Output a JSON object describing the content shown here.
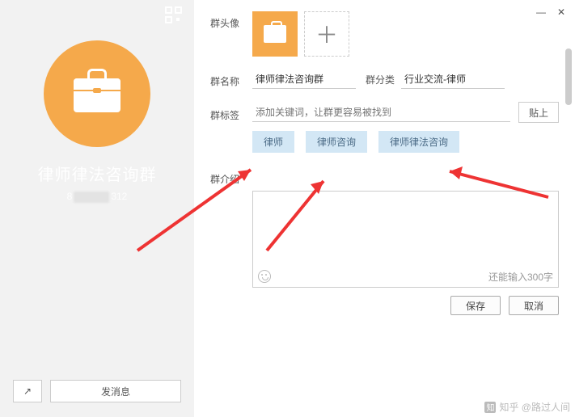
{
  "left": {
    "group_name": "律师律法咨询群",
    "group_id_prefix": "8",
    "group_id_suffix": "312",
    "share_icon": "↗",
    "send_msg": "发消息"
  },
  "win": {
    "min": "—",
    "close": "✕"
  },
  "labels": {
    "avatar": "群头像",
    "name": "群名称",
    "category": "群分类",
    "tag": "群标签",
    "intro": "群介绍"
  },
  "fields": {
    "name_value": "律师律法咨询群",
    "category_value": "行业交流-律师",
    "tag_placeholder": "添加关键词，让群更容易被找到",
    "paste": "贴上",
    "add_icon": "＋"
  },
  "tags": [
    "律师",
    "律师咨询",
    "律师律法咨询"
  ],
  "intro": {
    "counter": "还能输入300字"
  },
  "buttons": {
    "save": "保存",
    "cancel": "取消"
  },
  "watermark": {
    "logo": "知",
    "text": "知乎 @路过人间"
  }
}
